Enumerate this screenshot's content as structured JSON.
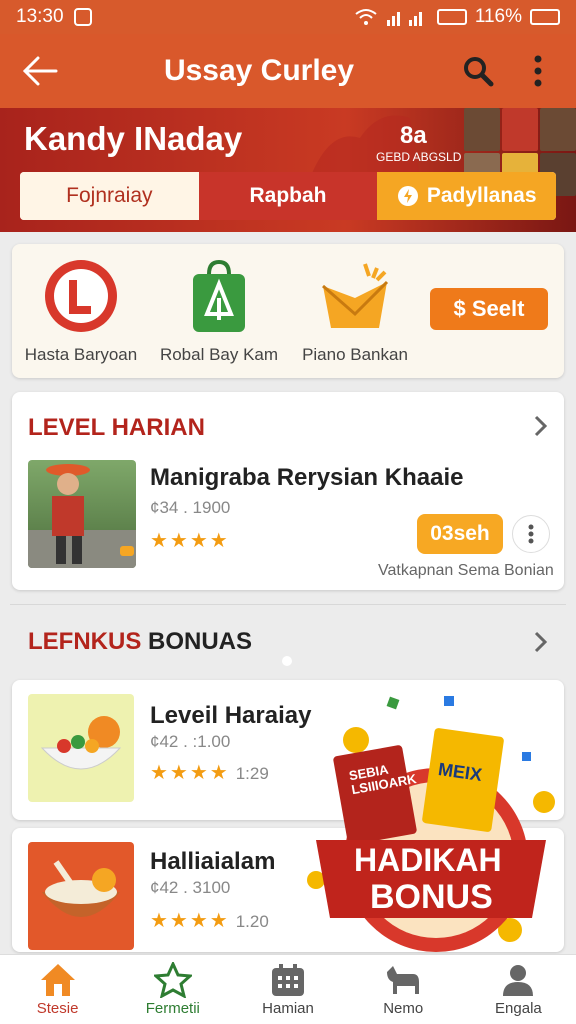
{
  "status_bar": {
    "time": "13:30",
    "battery": "116%"
  },
  "app_bar": {
    "title": "Ussay Curley"
  },
  "hero": {
    "name": "Kandy INaday",
    "code": "8a",
    "code_sub": "GEBD ABGSLD",
    "tabs": [
      {
        "label": "Fojnraiay"
      },
      {
        "label": "Rapbah"
      },
      {
        "label": "Padyllanas"
      }
    ]
  },
  "quick_actions": {
    "items": [
      {
        "label": "Hasta Baryoan",
        "icon": "l-circle-icon"
      },
      {
        "label": "Robal Bay Kam",
        "icon": "shopping-bag-icon"
      },
      {
        "label": "Piano Bankan",
        "icon": "gift-box-icon"
      }
    ],
    "seek_label": "$ Seelt"
  },
  "level_section": {
    "title_red": "LEVEL HARIAN",
    "item": {
      "title": "Manigraba Rerysian Khaaie",
      "price": "¢34 . 1900",
      "stars": "★★★★",
      "button_label": "03seh",
      "sub": "Vatkapnan Sema Bonian"
    }
  },
  "bonus_section": {
    "title_red": "LEFNKUS",
    "title_dark": "BONUAS",
    "items": [
      {
        "title": "Leveil Haraiay",
        "price": "¢42 . :1.00",
        "stars": "★★★★",
        "rating": "1:29"
      },
      {
        "title": "Halliaialam",
        "price": "¢42 . 3100",
        "stars": "★★★★",
        "rating": "1.20"
      }
    ],
    "promo": {
      "line1": "HADIKAH",
      "line2": "BONUS",
      "pack1": "SEBIA LSIIIOARK",
      "pack2": "MEIX"
    }
  },
  "bottom_nav": [
    {
      "label": "Stesie",
      "icon": "home-icon"
    },
    {
      "label": "Fermetii",
      "icon": "star-icon"
    },
    {
      "label": "Hamian",
      "icon": "calendar-icon"
    },
    {
      "label": "Nemo",
      "icon": "animal-icon"
    },
    {
      "label": "Engala",
      "icon": "profile-icon"
    }
  ],
  "colors": {
    "primary": "#d9582b",
    "accent": "#f5a623",
    "red": "#b3241c"
  }
}
